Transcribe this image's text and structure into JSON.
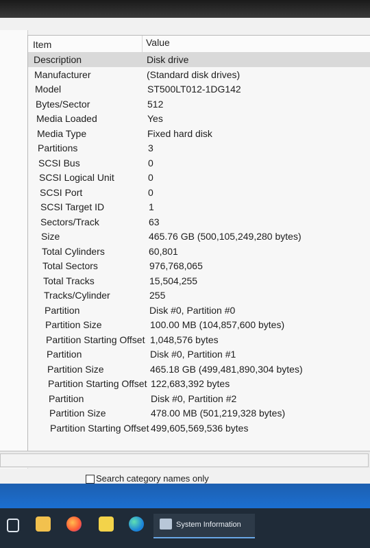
{
  "columns": {
    "item": "Item",
    "value": "Value"
  },
  "rows": [
    {
      "item": "Description",
      "value": "Disk drive"
    },
    {
      "item": "Manufacturer",
      "value": "(Standard disk drives)"
    },
    {
      "item": "Model",
      "value": "ST500LT012-1DG142"
    },
    {
      "item": "Bytes/Sector",
      "value": "512"
    },
    {
      "item": "Media Loaded",
      "value": "Yes"
    },
    {
      "item": "Media Type",
      "value": "Fixed hard disk"
    },
    {
      "item": "Partitions",
      "value": "3"
    },
    {
      "item": "SCSI Bus",
      "value": "0"
    },
    {
      "item": "SCSI Logical Unit",
      "value": "0"
    },
    {
      "item": "SCSI Port",
      "value": "0"
    },
    {
      "item": "SCSI Target ID",
      "value": "1"
    },
    {
      "item": "Sectors/Track",
      "value": "63"
    },
    {
      "item": "Size",
      "value": "465.76 GB (500,105,249,280 bytes)"
    },
    {
      "item": "Total Cylinders",
      "value": "60,801"
    },
    {
      "item": "Total Sectors",
      "value": "976,768,065"
    },
    {
      "item": "Total Tracks",
      "value": "15,504,255"
    },
    {
      "item": "Tracks/Cylinder",
      "value": "255"
    },
    {
      "item": "Partition",
      "value": "Disk #0, Partition #0"
    },
    {
      "item": "Partition Size",
      "value": "100.00 MB (104,857,600 bytes)"
    },
    {
      "item": "Partition Starting Offset",
      "value": "1,048,576 bytes"
    },
    {
      "item": "Partition",
      "value": "Disk #0, Partition #1"
    },
    {
      "item": "Partition Size",
      "value": "465.18 GB (499,481,890,304 bytes)"
    },
    {
      "item": "Partition Starting Offset",
      "value": "122,683,392 bytes"
    },
    {
      "item": "Partition",
      "value": "Disk #0, Partition #2"
    },
    {
      "item": "Partition Size",
      "value": "478.00 MB (501,219,328 bytes)"
    },
    {
      "item": "Partition Starting Offset",
      "value": "499,605,569,536 bytes"
    }
  ],
  "search": {
    "checkbox_label": "Search category names only"
  },
  "taskbar": {
    "task_label": "System Information",
    "icons": [
      "task-view-icon",
      "file-explorer-icon",
      "firefox-icon",
      "paper-app-icon",
      "edge-icon",
      "system-information-icon"
    ]
  }
}
